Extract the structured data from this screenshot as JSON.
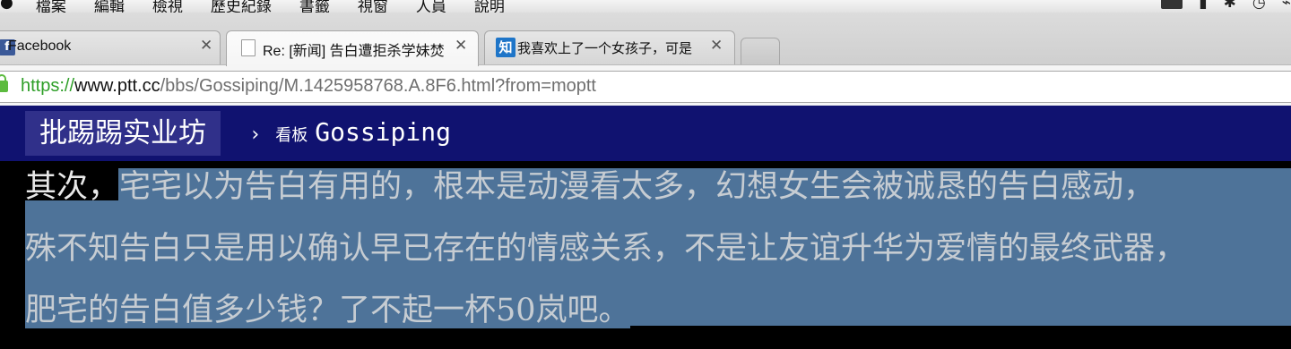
{
  "menubar": {
    "items": [
      "檔案",
      "編輯",
      "檢視",
      "歷史紀錄",
      "書籤",
      "視窗",
      "人員",
      "說明"
    ]
  },
  "tabs": [
    {
      "title": "Facebook",
      "favicon": "facebook-icon",
      "icon_text": "f",
      "icon_color": "#3b5998"
    },
    {
      "title": "Re: [新闻] 告白遭拒杀学妹焚",
      "favicon": "document-icon",
      "icon_text": "",
      "icon_color": "#ffffff"
    },
    {
      "title": "我喜欢上了一个女孩子，可是",
      "favicon": "zhihu-icon",
      "icon_text": "知",
      "icon_color": "#1e75c8"
    }
  ],
  "addressbar": {
    "scheme": "https://",
    "host": "www.ptt.cc",
    "path": "/bbs/Gossiping/M.1425958768.A.8F6.html?from=moptt"
  },
  "header": {
    "logo": "批踢踢实业坊",
    "separator": "›",
    "board_label": "看板",
    "board_name": "Gossiping"
  },
  "article": {
    "line1_plain": "其次，",
    "line1_selected": "宅宅以为告白有用的，根本是动漫看太多，幻想女生会被诚恳的告白感动，",
    "line2": "殊不知告白只是用以确认早已存在的情感关系，不是让友谊升华为爱情的最终武器，",
    "line3": "肥宅的告白值多少钱？了不起一杯50岚吧。"
  },
  "colors": {
    "header_bg": "#101270",
    "selection": "#4e7399",
    "https_green": "#2d9e27"
  }
}
